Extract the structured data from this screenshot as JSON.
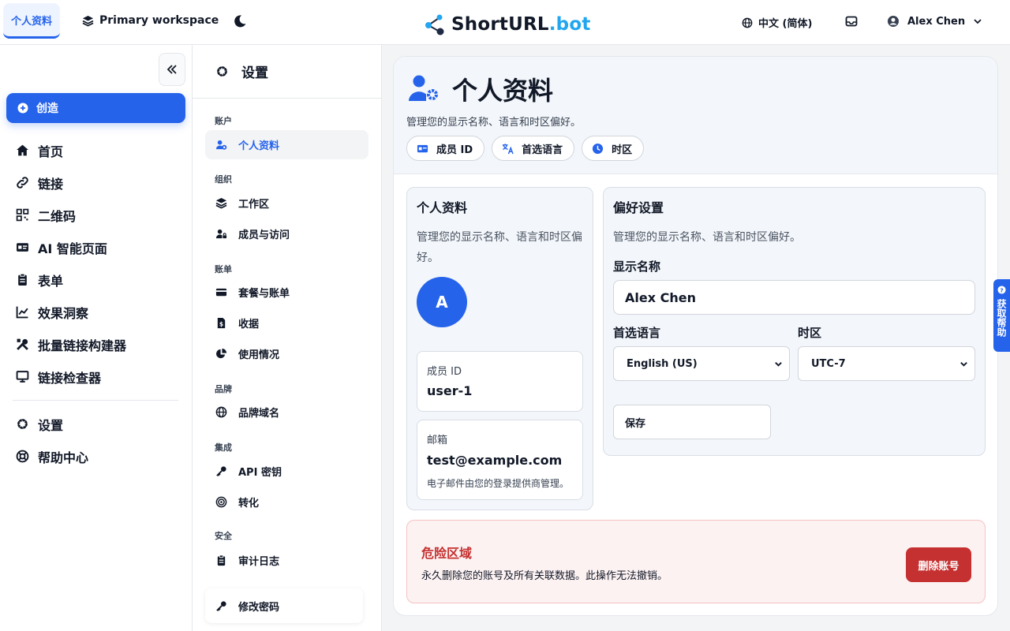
{
  "topbar": {
    "active_tab": "个人资料",
    "workspace": "Primary workspace",
    "brand_main": "ShortURL",
    "brand_dot": ".bot",
    "language": "中文 (简体)",
    "user_name": "Alex Chen"
  },
  "sidebar": {
    "create": "创造",
    "items": [
      "首页",
      "链接",
      "二维码",
      "AI 智能页面",
      "表单",
      "效果洞察",
      "批量链接构建器",
      "链接检查器"
    ],
    "bottom_items": [
      "设置",
      "帮助中心"
    ]
  },
  "settings": {
    "title": "设置",
    "groups": {
      "account": "账户",
      "org": "组织",
      "billing": "账单",
      "brand": "品牌",
      "integrations": "集成",
      "security": "安全"
    },
    "items": {
      "profile": "个人资料",
      "workspaces": "工作区",
      "members": "成员与访问",
      "plans": "套餐与账单",
      "receipts": "收据",
      "usage": "使用情况",
      "domains": "品牌域名",
      "api_keys": "API 密钥",
      "conversions": "转化",
      "audit": "审计日志",
      "password": "修改密码"
    }
  },
  "header": {
    "title": "个人资料",
    "subtitle": "管理您的显示名称、语言和时区偏好。",
    "chips": [
      "成员 ID",
      "首选语言",
      "时区"
    ]
  },
  "profile_panel": {
    "title": "个人资料",
    "desc": "管理您的显示名称、语言和时区偏好。",
    "avatar": "A",
    "member_id_label": "成员 ID",
    "member_id": "user-1",
    "email_label": "邮箱",
    "email": "test@example.com",
    "email_note": "电子邮件由您的登录提供商管理。"
  },
  "prefs_panel": {
    "title": "偏好设置",
    "desc": "管理您的显示名称、语言和时区偏好。",
    "display_name_label": "显示名称",
    "display_name": "Alex Chen",
    "language_label": "首选语言",
    "language": "English (US)",
    "timezone_label": "时区",
    "timezone": "UTC-7",
    "save": "保存"
  },
  "danger": {
    "title": "危险区域",
    "desc": "永久删除您的账号及所有关联数据。此操作无法撤销。",
    "button": "删除账号"
  },
  "help_tab": "获取帮助",
  "colors": {
    "accent": "#2563eb",
    "danger": "#c53030",
    "panel_bg": "#f3f6fa"
  }
}
